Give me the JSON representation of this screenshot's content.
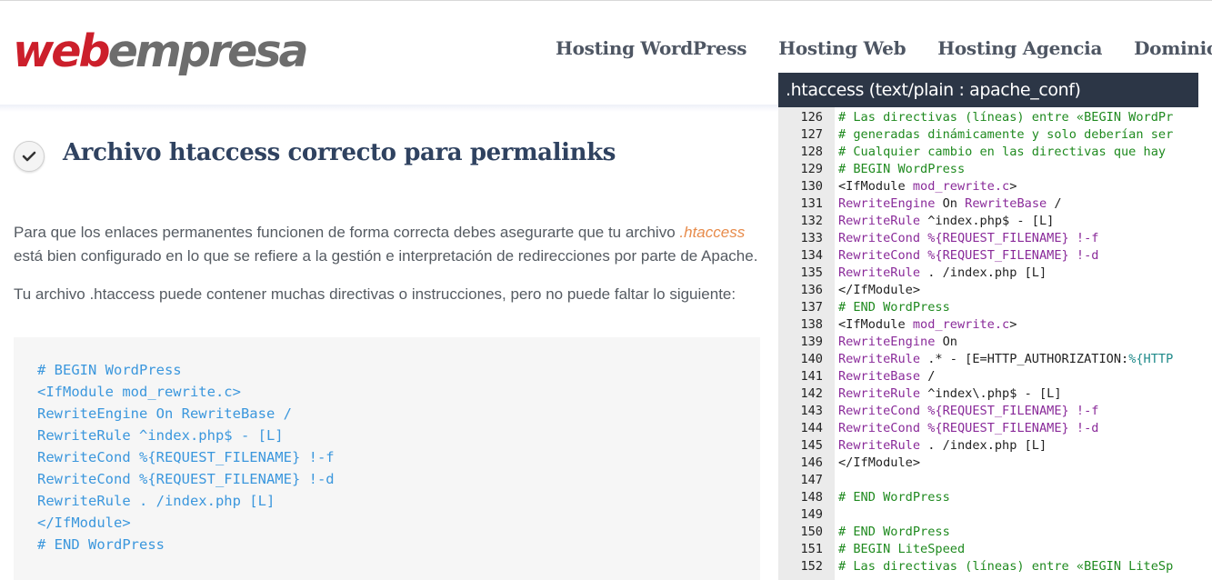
{
  "header": {
    "logo_red": "web",
    "logo_grey": "empresa",
    "nav": [
      "Hosting WordPress",
      "Hosting Web",
      "Hosting Agencia",
      "Dominios"
    ]
  },
  "article": {
    "title": "Archivo htaccess correcto para permalinks",
    "p1_before": "Para que los enlaces permanentes funcionen de forma correcta debes asegurarte que tu archivo ",
    "p1_highlight": ".htaccess",
    "p1_after": " está bien configurado en lo que se refiere a la gestión e interpretación de redirecciones por parte de Apache.",
    "p2": "Tu archivo .htaccess puede contener muchas directivas o instrucciones, pero no puede faltar lo siguiente:",
    "code": "# BEGIN WordPress\n<IfModule mod_rewrite.c>\nRewriteEngine On RewriteBase /\nRewriteRule ^index.php$ - [L]\nRewriteCond %{REQUEST_FILENAME} !-f\nRewriteCond %{REQUEST_FILENAME} !-d\nRewriteRule . /index.php [L]\n</IfModule>\n# END WordPress"
  },
  "editor": {
    "title": ".htaccess (text/plain : apache_conf)",
    "lines": [
      {
        "n": "126",
        "parts": [
          [
            "c-comment",
            "# Las directivas (líneas) entre «BEGIN WordPr"
          ]
        ]
      },
      {
        "n": "127",
        "parts": [
          [
            "c-comment",
            "# generadas dinámicamente y solo deberían ser"
          ]
        ]
      },
      {
        "n": "128",
        "parts": [
          [
            "c-comment",
            "# Cualquier cambio en las directivas que hay"
          ]
        ]
      },
      {
        "n": "129",
        "parts": [
          [
            "c-comment",
            "# BEGIN WordPress"
          ]
        ]
      },
      {
        "n": "130",
        "parts": [
          [
            "c-tag",
            "<IfModule "
          ],
          [
            "c-mod",
            "mod_rewrite.c"
          ],
          [
            "c-tag",
            ">"
          ]
        ]
      },
      {
        "n": "131",
        "parts": [
          [
            "c-kw",
            "RewriteEngine"
          ],
          [
            "c-plain",
            " On "
          ],
          [
            "c-kw",
            "RewriteBase"
          ],
          [
            "c-plain",
            " /"
          ]
        ]
      },
      {
        "n": "132",
        "parts": [
          [
            "c-kw",
            "RewriteRule"
          ],
          [
            "c-plain",
            " ^index.php$ - [L]"
          ]
        ]
      },
      {
        "n": "133",
        "parts": [
          [
            "c-kw",
            "RewriteCond"
          ],
          [
            "c-plain",
            " "
          ],
          [
            "c-var",
            "%{REQUEST_FILENAME}"
          ],
          [
            "c-plain",
            " "
          ],
          [
            "c-flag",
            "!-f"
          ]
        ]
      },
      {
        "n": "134",
        "parts": [
          [
            "c-kw",
            "RewriteCond"
          ],
          [
            "c-plain",
            " "
          ],
          [
            "c-var",
            "%{REQUEST_FILENAME}"
          ],
          [
            "c-plain",
            " "
          ],
          [
            "c-flag",
            "!-d"
          ]
        ]
      },
      {
        "n": "135",
        "parts": [
          [
            "c-kw",
            "RewriteRule"
          ],
          [
            "c-plain",
            " . /index.php [L]"
          ]
        ]
      },
      {
        "n": "136",
        "parts": [
          [
            "c-tag",
            "</IfModule>"
          ]
        ]
      },
      {
        "n": "137",
        "parts": [
          [
            "c-comment",
            "# END WordPress"
          ]
        ]
      },
      {
        "n": "138",
        "parts": [
          [
            "c-tag",
            "<IfModule "
          ],
          [
            "c-mod",
            "mod_rewrite.c"
          ],
          [
            "c-tag",
            ">"
          ]
        ]
      },
      {
        "n": "139",
        "parts": [
          [
            "c-kw",
            "RewriteEngine"
          ],
          [
            "c-plain",
            " On"
          ]
        ]
      },
      {
        "n": "140",
        "parts": [
          [
            "c-kw",
            "RewriteRule"
          ],
          [
            "c-plain",
            " .* - [E=HTTP_AUTHORIZATION:"
          ],
          [
            "c-url",
            "%{HTTP"
          ]
        ]
      },
      {
        "n": "141",
        "parts": [
          [
            "c-kw",
            "RewriteBase"
          ],
          [
            "c-plain",
            " /"
          ]
        ]
      },
      {
        "n": "142",
        "parts": [
          [
            "c-kw",
            "RewriteRule"
          ],
          [
            "c-plain",
            " ^index\\.php$ - [L]"
          ]
        ]
      },
      {
        "n": "143",
        "parts": [
          [
            "c-kw",
            "RewriteCond"
          ],
          [
            "c-plain",
            " "
          ],
          [
            "c-var",
            "%{REQUEST_FILENAME}"
          ],
          [
            "c-plain",
            " "
          ],
          [
            "c-flag",
            "!-f"
          ]
        ]
      },
      {
        "n": "144",
        "parts": [
          [
            "c-kw",
            "RewriteCond"
          ],
          [
            "c-plain",
            " "
          ],
          [
            "c-var",
            "%{REQUEST_FILENAME}"
          ],
          [
            "c-plain",
            " "
          ],
          [
            "c-flag",
            "!-d"
          ]
        ]
      },
      {
        "n": "145",
        "parts": [
          [
            "c-kw",
            "RewriteRule"
          ],
          [
            "c-plain",
            " . /index.php [L]"
          ]
        ]
      },
      {
        "n": "146",
        "parts": [
          [
            "c-tag",
            "</IfModule>"
          ]
        ]
      },
      {
        "n": "147",
        "parts": []
      },
      {
        "n": "148",
        "parts": [
          [
            "c-comment",
            "# END WordPress"
          ]
        ]
      },
      {
        "n": "149",
        "parts": []
      },
      {
        "n": "150",
        "parts": [
          [
            "c-comment",
            "# END WordPress"
          ]
        ]
      },
      {
        "n": "151",
        "parts": [
          [
            "c-comment",
            "# BEGIN LiteSpeed"
          ]
        ]
      },
      {
        "n": "152",
        "parts": [
          [
            "c-comment",
            "# Las directivas (líneas) entre «BEGIN LiteSp"
          ]
        ]
      }
    ]
  },
  "colors": {
    "brand_red": "#cc1f2b",
    "editor_title_bg": "#2c3646",
    "code_blue": "#3b97dd",
    "title_navy": "#2f4260"
  },
  "icons": {
    "heading_icon": "check-circle-icon"
  }
}
